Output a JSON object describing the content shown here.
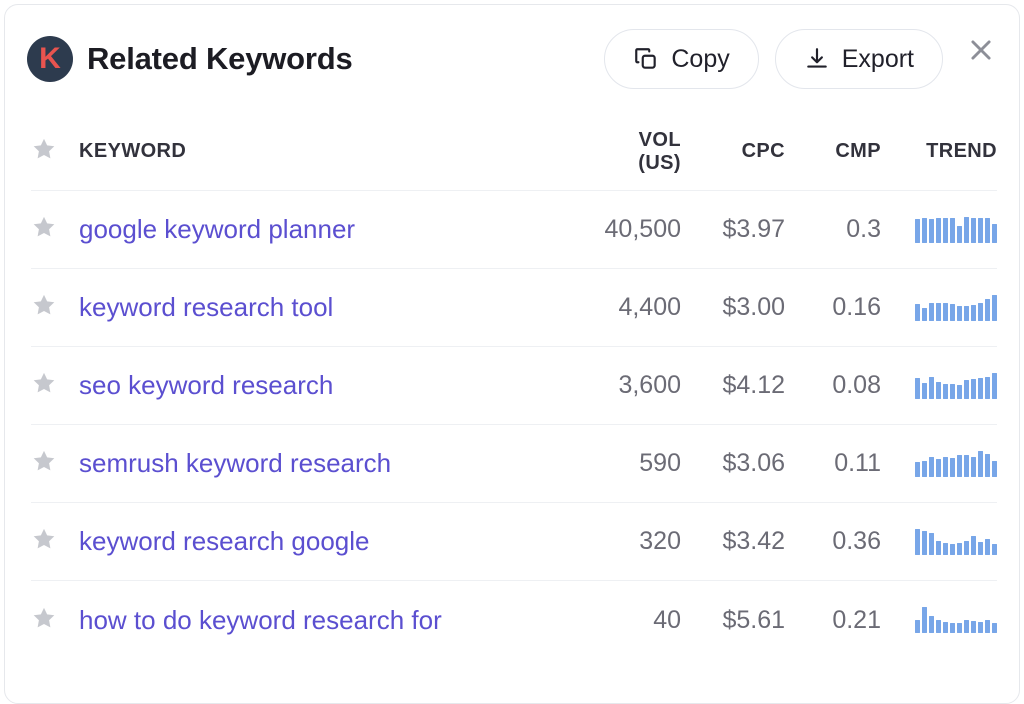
{
  "header": {
    "logo_letter": "K",
    "title": "Related Keywords",
    "copy_label": "Copy",
    "export_label": "Export",
    "copy_icon": "copy-icon",
    "export_icon": "download-icon",
    "close_icon": "close-icon",
    "accent_color": "#e8544f",
    "logo_bg_color": "#2d3b4e"
  },
  "table": {
    "columns": {
      "star": "star-icon",
      "keyword": "KEYWORD",
      "volume": "VOL\n(US)",
      "cpc": "CPC",
      "cmp": "CMP",
      "trend": "TREND"
    },
    "link_color": "#5b4fd0",
    "trend_bar_color": "#78a6e8",
    "rows": [
      {
        "keyword": "google keyword planner",
        "volume": "40,500",
        "cpc": "$3.97",
        "cmp": "0.3",
        "trend": [
          72,
          74,
          73,
          75,
          74,
          76,
          50,
          78,
          76,
          74,
          75,
          56
        ]
      },
      {
        "keyword": "keyword research tool",
        "volume": "4,400",
        "cpc": "$3.00",
        "cmp": "0.16",
        "trend": [
          55,
          44,
          58,
          60,
          59,
          55,
          48,
          48,
          52,
          60,
          72,
          86
        ]
      },
      {
        "keyword": "seo keyword research",
        "volume": "3,600",
        "cpc": "$4.12",
        "cmp": "0.08",
        "trend": [
          68,
          52,
          70,
          56,
          50,
          48,
          46,
          60,
          64,
          68,
          70,
          84
        ]
      },
      {
        "keyword": "semrush keyword research",
        "volume": "590",
        "cpc": "$3.06",
        "cmp": "0.11",
        "trend": [
          50,
          52,
          64,
          58,
          66,
          60,
          72,
          70,
          64,
          84,
          74,
          52
        ]
      },
      {
        "keyword": "keyword research google",
        "volume": "320",
        "cpc": "$3.42",
        "cmp": "0.36",
        "trend": [
          86,
          78,
          74,
          46,
          40,
          38,
          40,
          46,
          62,
          44,
          52,
          38
        ]
      },
      {
        "keyword": "how to do keyword research for",
        "volume": "40",
        "cpc": "$5.61",
        "cmp": "0.21",
        "trend": [
          30,
          60,
          40,
          30,
          26,
          24,
          22,
          30,
          28,
          26,
          30,
          24
        ]
      }
    ]
  }
}
